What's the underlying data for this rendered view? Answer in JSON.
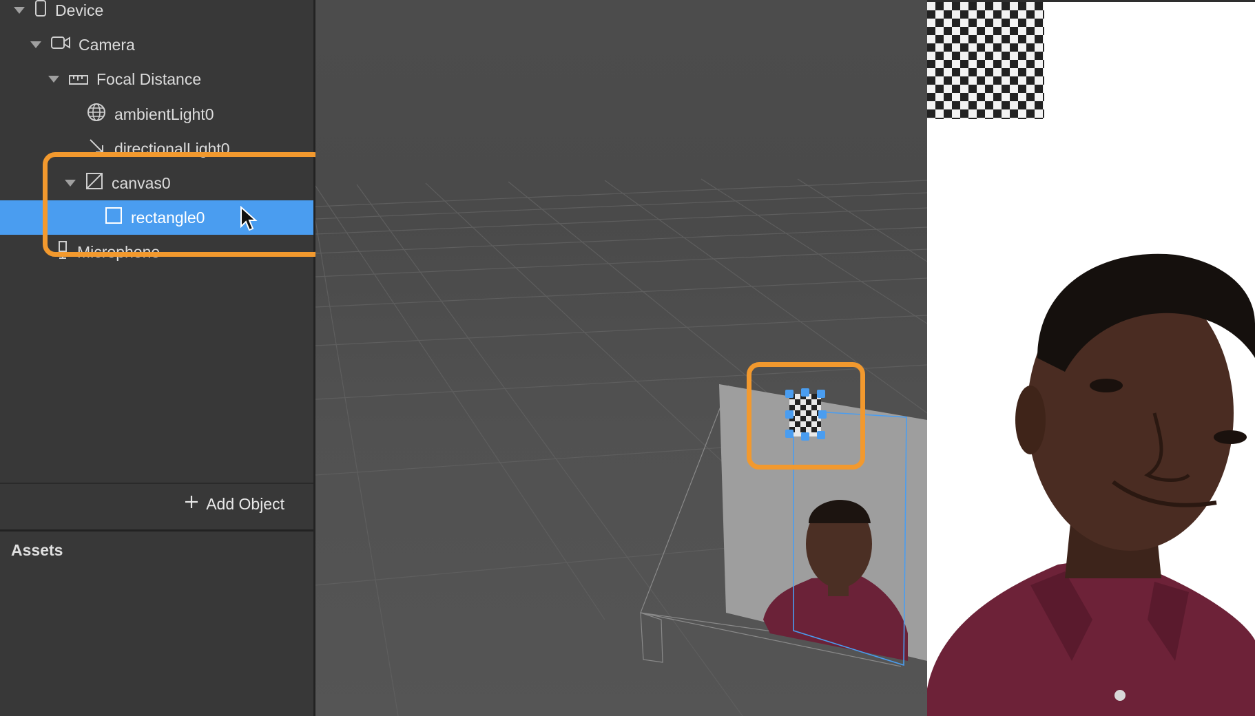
{
  "scene_tree": {
    "items": [
      {
        "label": "Device",
        "icon": "phone-icon"
      },
      {
        "label": "Camera",
        "icon": "camera-icon"
      },
      {
        "label": "Focal Distance",
        "icon": "ruler-icon"
      },
      {
        "label": "ambientLight0",
        "icon": "globe-icon"
      },
      {
        "label": "directionalLight0",
        "icon": "directional-light-icon"
      },
      {
        "label": "canvas0",
        "icon": "canvas-icon"
      },
      {
        "label": "rectangle0",
        "icon": "rectangle-icon",
        "selected": true
      },
      {
        "label": "Microphone",
        "icon": "microphone-icon"
      }
    ],
    "add_object_label": "Add Object"
  },
  "assets": {
    "title": "Assets"
  },
  "colors": {
    "selection": "#4a9df0",
    "highlight": "#f2992e",
    "panel": "#383838"
  }
}
